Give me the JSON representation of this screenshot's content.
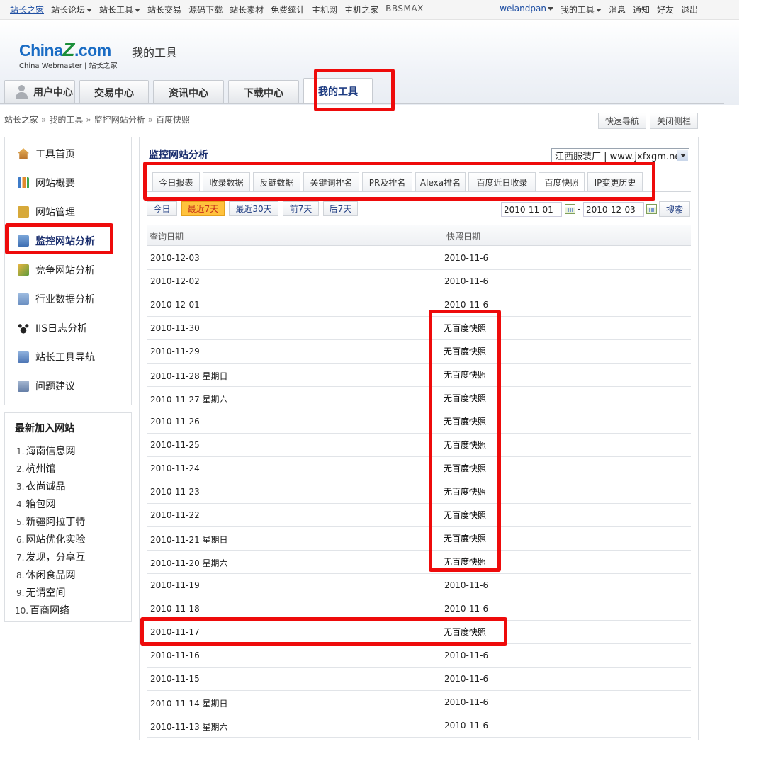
{
  "topbar": {
    "left": [
      {
        "label": "站长之家",
        "caret": false
      },
      {
        "label": "站长论坛",
        "caret": true
      },
      {
        "label": "站长工具",
        "caret": true
      },
      {
        "label": "站长交易",
        "caret": false
      },
      {
        "label": "源码下载",
        "caret": false
      },
      {
        "label": "站长素材",
        "caret": false
      },
      {
        "label": "免费统计",
        "caret": false
      },
      {
        "label": "主机网",
        "caret": false
      },
      {
        "label": "主机之家",
        "caret": false
      },
      {
        "label": "BBSMAX",
        "caret": false
      }
    ],
    "right": [
      {
        "label": "weiandpan",
        "caret": true
      },
      {
        "label": "我的工具",
        "caret": true
      },
      {
        "label": "消息",
        "caret": false
      },
      {
        "label": "通知",
        "caret": false
      },
      {
        "label": "好友",
        "caret": false
      },
      {
        "label": "退出",
        "caret": false
      }
    ]
  },
  "header": {
    "logo_main": "China",
    "logo_z": "Z",
    "logo_suffix": ".com",
    "logo_sub": "China Webmaster | 站长之家",
    "title": "我的工具"
  },
  "tabs": [
    "用户中心",
    "交易中心",
    "资讯中心",
    "下载中心",
    "我的工具"
  ],
  "breadcrumb": [
    "站长之家",
    "我的工具",
    "监控网站分析",
    "百度快照"
  ],
  "breadcrumb_sep": "»",
  "right_buttons": [
    "快速导航",
    "关闭侧栏"
  ],
  "sidebar": {
    "items": [
      {
        "label": "工具首页",
        "icon": "home-icon"
      },
      {
        "label": "网站概要",
        "icon": "bar-chart-icon"
      },
      {
        "label": "网站管理",
        "icon": "lock-icon"
      },
      {
        "label": "监控网站分析",
        "icon": "monitor-icon",
        "active": true
      },
      {
        "label": "竞争网站分析",
        "icon": "compete-icon"
      },
      {
        "label": "行业数据分析",
        "icon": "industry-icon"
      },
      {
        "label": "IIS日志分析",
        "icon": "paw-icon"
      },
      {
        "label": "站长工具导航",
        "icon": "nav-icon"
      },
      {
        "label": "问题建议",
        "icon": "feedback-icon"
      }
    ],
    "new_sites_title": "最新加入网站",
    "new_sites": [
      "海南信息网",
      "杭州馆",
      "衣尚诚品",
      "箱包网",
      "新疆阿拉丁特",
      "网站优化实验",
      "发现，分享互",
      "休闲食品网",
      "无谓空间",
      "百商网络"
    ]
  },
  "main": {
    "title": "监控网站分析",
    "site_select": "江西服装厂 | www.jxfxgm.net",
    "subtabs": [
      "今日报表",
      "收录数据",
      "反链数据",
      "关键词排名",
      "PR及排名",
      "Alexa排名",
      "百度近日收录",
      "百度快照",
      "IP变更历史"
    ],
    "active_subtab": "百度快照",
    "filters": [
      "今日",
      "最近7天",
      "最近30天",
      "前7天",
      "后7天"
    ],
    "active_filter": "最近7天",
    "date_from": "2010-11-01",
    "date_sep": "-",
    "date_to": "2010-12-03",
    "search_label": "搜索",
    "columns": [
      "查询日期",
      "快照日期"
    ],
    "rows": [
      {
        "date": "2010-12-03",
        "snap": "2010-11-6"
      },
      {
        "date": "2010-12-02",
        "snap": "2010-11-6"
      },
      {
        "date": "2010-12-01",
        "snap": "2010-11-6"
      },
      {
        "date": "2010-11-30",
        "snap": "无百度快照"
      },
      {
        "date": "2010-11-29",
        "snap": "无百度快照"
      },
      {
        "date": "2010-11-28 星期日",
        "snap": "无百度快照"
      },
      {
        "date": "2010-11-27 星期六",
        "snap": "无百度快照"
      },
      {
        "date": "2010-11-26",
        "snap": "无百度快照"
      },
      {
        "date": "2010-11-25",
        "snap": "无百度快照"
      },
      {
        "date": "2010-11-24",
        "snap": "无百度快照"
      },
      {
        "date": "2010-11-23",
        "snap": "无百度快照"
      },
      {
        "date": "2010-11-22",
        "snap": "无百度快照"
      },
      {
        "date": "2010-11-21 星期日",
        "snap": "无百度快照"
      },
      {
        "date": "2010-11-20 星期六",
        "snap": "无百度快照"
      },
      {
        "date": "2010-11-19",
        "snap": "2010-11-6"
      },
      {
        "date": "2010-11-18",
        "snap": "2010-11-6"
      },
      {
        "date": "2010-11-17",
        "snap": "无百度快照"
      },
      {
        "date": "2010-11-16",
        "snap": "2010-11-6"
      },
      {
        "date": "2010-11-15",
        "snap": "2010-11-6"
      },
      {
        "date": "2010-11-14 星期日",
        "snap": "2010-11-6"
      },
      {
        "date": "2010-11-13 星期六",
        "snap": "2010-11-6"
      }
    ]
  },
  "colors": {
    "highlight": "#ee0b0b",
    "active_filter": "#ffc23d",
    "link_blue": "#1f3d82"
  }
}
